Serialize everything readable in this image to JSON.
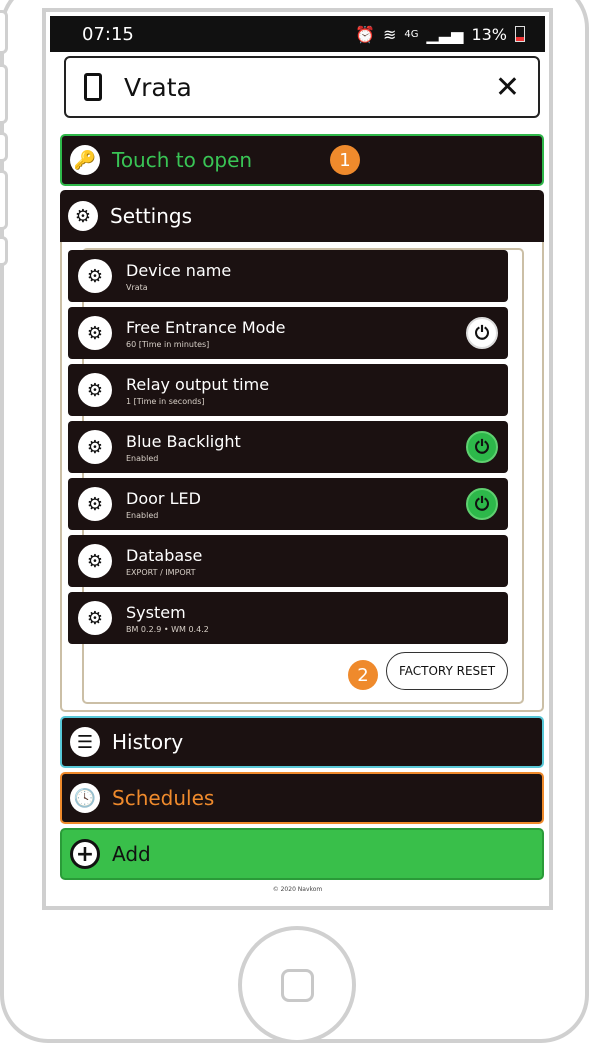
{
  "status_bar": {
    "time": "07:15",
    "network": "4G",
    "battery": "13%"
  },
  "header": {
    "title": "Vrata",
    "close": "✕"
  },
  "menu": {
    "touch_to_open": "Touch to open",
    "settings": "Settings",
    "history": "History",
    "schedules": "Schedules",
    "add": "Add"
  },
  "badges": [
    "1",
    "2"
  ],
  "settings_items": [
    {
      "title": "Device name",
      "detail": "Vrata",
      "toggle": "none"
    },
    {
      "title": "Free Entrance Mode",
      "detail": "60 [Time in minutes]",
      "toggle": "off"
    },
    {
      "title": "Relay output time",
      "detail": "1 [Time in seconds]",
      "toggle": "none"
    },
    {
      "title": "Blue Backlight",
      "detail": "Enabled",
      "toggle": "on"
    },
    {
      "title": "Door LED",
      "detail": "Enabled",
      "toggle": "on"
    },
    {
      "title": "Database",
      "detail": "EXPORT / IMPORT",
      "toggle": "none"
    },
    {
      "title": "System",
      "detail": "BM 0.2.9 • WM 0.4.2",
      "toggle": "none"
    }
  ],
  "factory_reset_label": "FACTORY RESET",
  "footer": "© 2020 Navkom",
  "colors": {
    "green": "#39c455",
    "orange": "#ef8a2c",
    "cyan": "#58c8d8",
    "dark": "#1b1111"
  }
}
